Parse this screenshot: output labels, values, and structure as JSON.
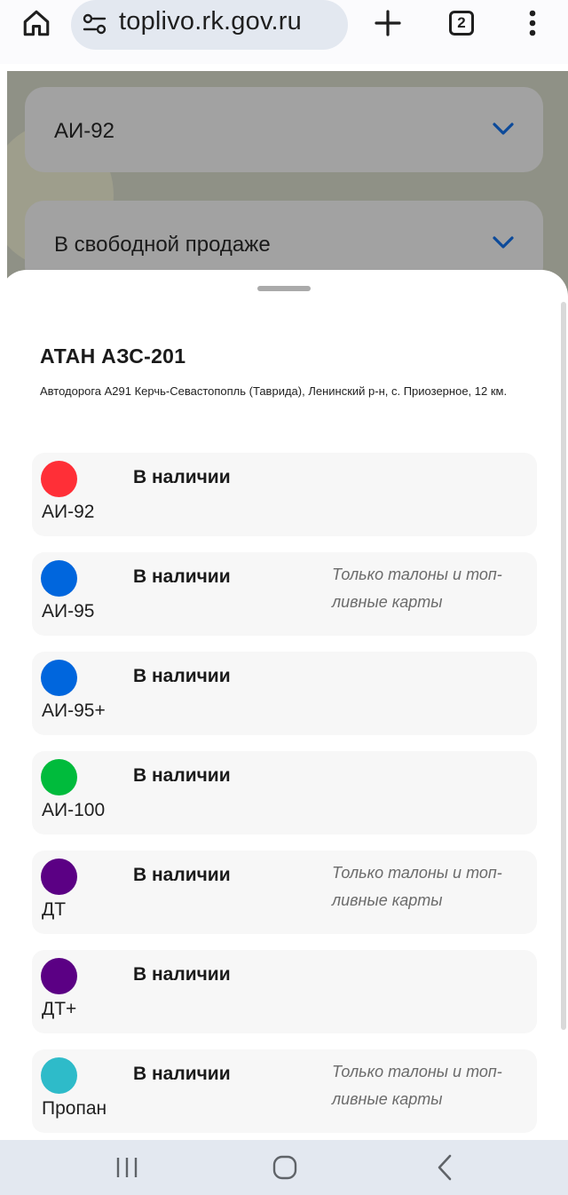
{
  "browser": {
    "url": "toplivo.rk.gov.ru",
    "tab_count": "2"
  },
  "filters": {
    "fuel_type": "АИ-92",
    "sale_type": "В свободной продаже"
  },
  "station": {
    "name": "АТАН АЗС-201",
    "address": "Автодорога А291 Керчь-Севастопопль (Таврида), Ленинский р-н, с. Приозерное, 12 км."
  },
  "fuels": [
    {
      "name": "АИ-92",
      "status": "В наличии",
      "note": "",
      "color": "#ff2f37"
    },
    {
      "name": "АИ-95",
      "status": "В наличии",
      "note": "Только талоны и топ-ливные карты",
      "color": "#0066dd"
    },
    {
      "name": "АИ-95+",
      "status": "В наличии",
      "note": "",
      "color": "#0066dd"
    },
    {
      "name": "АИ-100",
      "status": "В наличии",
      "note": "",
      "color": "#00bb3c"
    },
    {
      "name": "ДТ",
      "status": "В наличии",
      "note": "Только талоны и топ-ливные карты",
      "color": "#5b0084"
    },
    {
      "name": "ДТ+",
      "status": "В наличии",
      "note": "",
      "color": "#5b0084"
    },
    {
      "name": "Пропан",
      "status": "В наличии",
      "note": "Только талоны и топ-ливные карты",
      "color": "#2ebbc9"
    }
  ],
  "icons": {
    "home": "home-icon",
    "site_settings": "site-settings-icon",
    "new_tab": "plus-icon",
    "tabs": "tabs-counter-icon",
    "menu": "more-vertical-icon",
    "chevron": "chevron-down-icon",
    "recents": "recent-apps-icon",
    "nav_home": "nav-home-icon",
    "back": "back-icon"
  },
  "colors": {
    "accent": "#1565c0",
    "url_bar": "#e3e8f0",
    "sheet": "#ffffff",
    "row_bg": "#f7f7f7"
  }
}
